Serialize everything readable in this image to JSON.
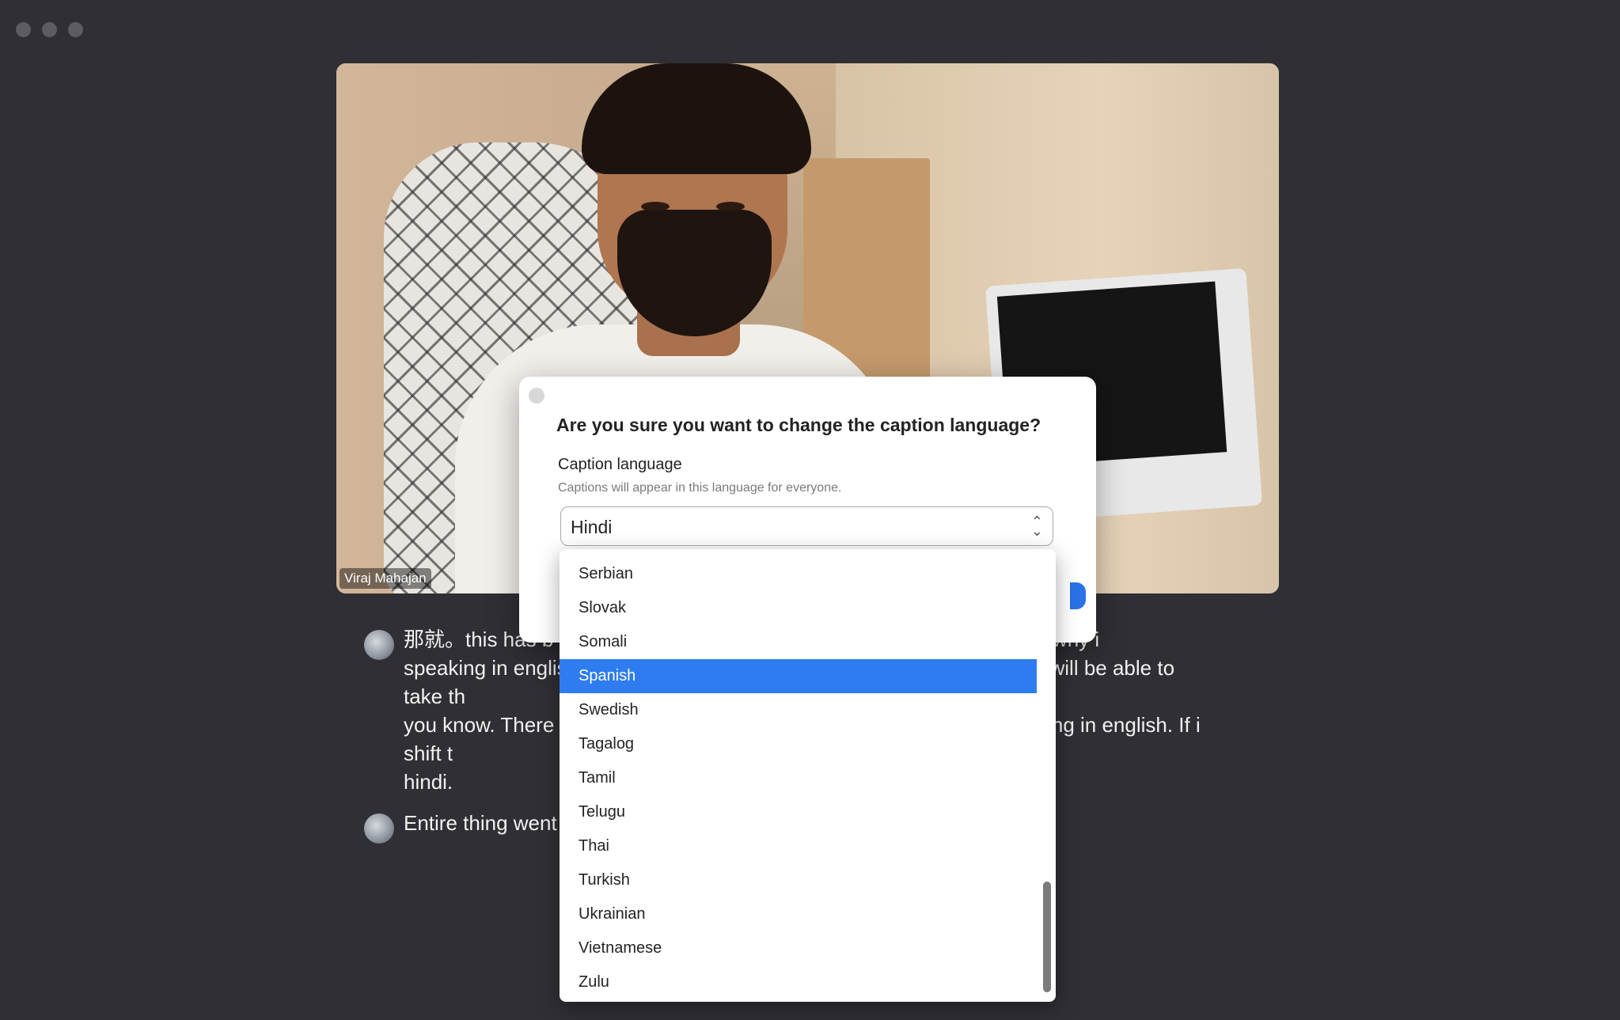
{
  "window": {
    "traffic_lights": [
      "close",
      "minimize",
      "zoom"
    ]
  },
  "video": {
    "participant_name": "Viraj Mahajan"
  },
  "captions": [
    {
      "text": "那就。this has b                                              mes along。 I don't know why i                                              speaking in english, and the                                              f whether this will be able to take th                                              t so far it's good. I have no compla                                              you know. There was a contextua                                              ly speaking in english. If i shift t                                              or not, so may try. Go wrong, ki                                              hindi."
    },
    {
      "text": "Entire thing went"
    }
  ],
  "dialog": {
    "title": "Are you sure you want to change the caption language?",
    "field_label": "Caption language",
    "field_hint": "Captions will appear in this language for everyone.",
    "selected_value": "Hindi"
  },
  "dropdown": {
    "options": [
      "Serbian",
      "Slovak",
      "Somali",
      "Spanish",
      "Swedish",
      "Tagalog",
      "Tamil",
      "Telugu",
      "Thai",
      "Turkish",
      "Ukrainian",
      "Vietnamese",
      "Zulu"
    ],
    "highlighted": "Spanish"
  },
  "colors": {
    "background": "#2f2f35",
    "highlight": "#2f7cf0",
    "caption_text": "#f2f2f2"
  }
}
